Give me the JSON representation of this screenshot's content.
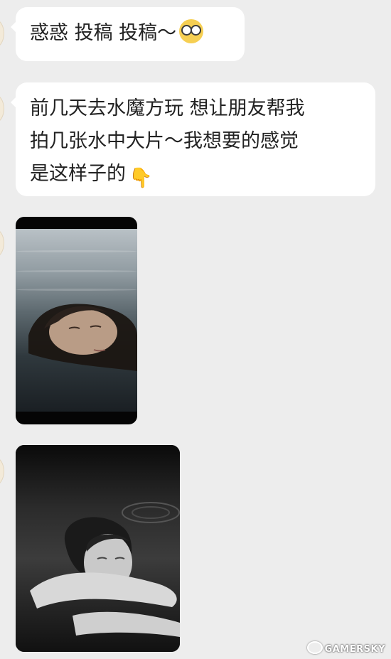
{
  "messages": [
    {
      "text": "惑惑 投稿 投稿～",
      "emoji": "nerd-glasses-emoji"
    },
    {
      "lines": [
        "前几天去水魔方玩 想让朋友帮我",
        "拍几张水中大片～我想要的感觉",
        "是这样子的"
      ],
      "emoji_char": "👇",
      "emoji": "pointing-down-hand-emoji"
    }
  ],
  "photos": [
    {
      "subject": "woman floating on water, color-toned"
    },
    {
      "subject": "woman in water, black and white"
    }
  ],
  "watermark": {
    "text": "GAMERSKY",
    "icon": "weibo-icon"
  },
  "colors": {
    "background": "#ededed",
    "bubble": "#ffffff",
    "text": "#222222"
  }
}
